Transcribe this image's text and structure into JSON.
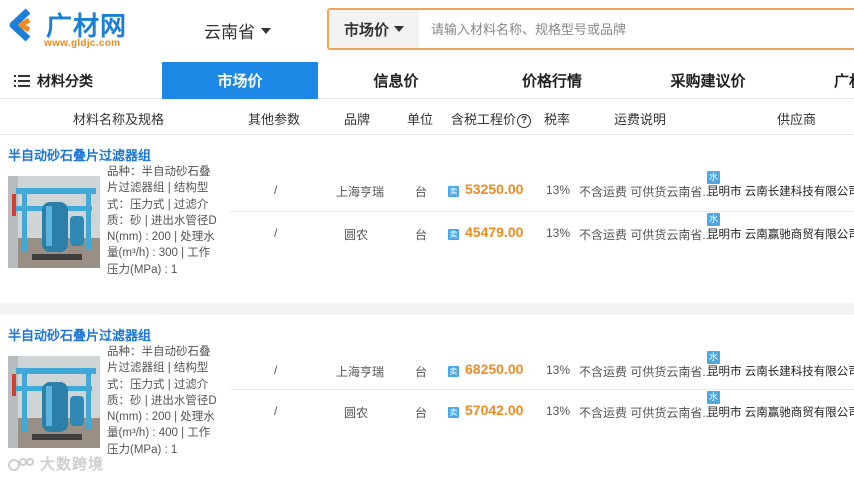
{
  "header": {
    "logo_text": "广材网",
    "logo_url": "www.gldjc.com",
    "region": "云南省",
    "search_type": "市场价",
    "search_placeholder": "请输入材料名称、规格型号或品牌"
  },
  "nav": {
    "category_label": "材料分类",
    "tabs": [
      {
        "label": "市场价",
        "active": true
      },
      {
        "label": "信息价",
        "active": false
      },
      {
        "label": "价格行情",
        "active": false
      },
      {
        "label": "采购建议价",
        "active": false
      },
      {
        "label": "广材",
        "active": false
      }
    ]
  },
  "columns": {
    "name": "材料名称及规格",
    "params": "其他参数",
    "brand": "品牌",
    "unit": "单位",
    "price": "含税工程价",
    "tax": "税率",
    "freight": "运费说明",
    "supplier": "供应商"
  },
  "products": [
    {
      "title": "半自动砂石叠片过滤器组",
      "description": "品种：半自动砂石叠片过滤器组 | 结构型式：压力式 | 过滤介质：砂 | 进出水管径DN(mm) : 200 | 处理水量(m³/h) : 300 | 工作压力(MPa) : 1",
      "rows": [
        {
          "params": "/",
          "brand": "上海亨瑞",
          "unit": "台",
          "price": "53250.00",
          "tax": "13%",
          "freight": "不含运费 可供货云南省...",
          "badge": "水",
          "supplier": "昆明市 云南长建科技有限公司"
        },
        {
          "params": "/",
          "brand": "圆农",
          "unit": "台",
          "price": "45479.00",
          "tax": "13%",
          "freight": "不含运费 可供货云南省...",
          "badge": "水",
          "supplier": "昆明市 云南赢驰商贸有限公司"
        }
      ]
    },
    {
      "title": "半自动砂石叠片过滤器组",
      "description": "品种：半自动砂石叠片过滤器组 | 结构型式：压力式 | 过滤介质：砂 | 进出水管径DN(mm) : 200 | 处理水量(m³/h) : 400 | 工作压力(MPa) : 1",
      "rows": [
        {
          "params": "/",
          "brand": "上海亨瑞",
          "unit": "台",
          "price": "68250.00",
          "tax": "13%",
          "freight": "不含运费 可供货云南省...",
          "badge": "水",
          "supplier": "昆明市 云南长建科技有限公司"
        },
        {
          "params": "/",
          "brand": "圆农",
          "unit": "台",
          "price": "57042.00",
          "tax": "13%",
          "freight": "不含运费 可供货云南省...",
          "badge": "水",
          "supplier": "昆明市 云南赢驰商贸有限公司"
        }
      ]
    }
  ],
  "price_tag_icon": "卖",
  "watermark": "大数跨境",
  "colors": {
    "accent": "#1d87e5",
    "price": "#f28a1b",
    "search_border": "#f0a35a"
  }
}
